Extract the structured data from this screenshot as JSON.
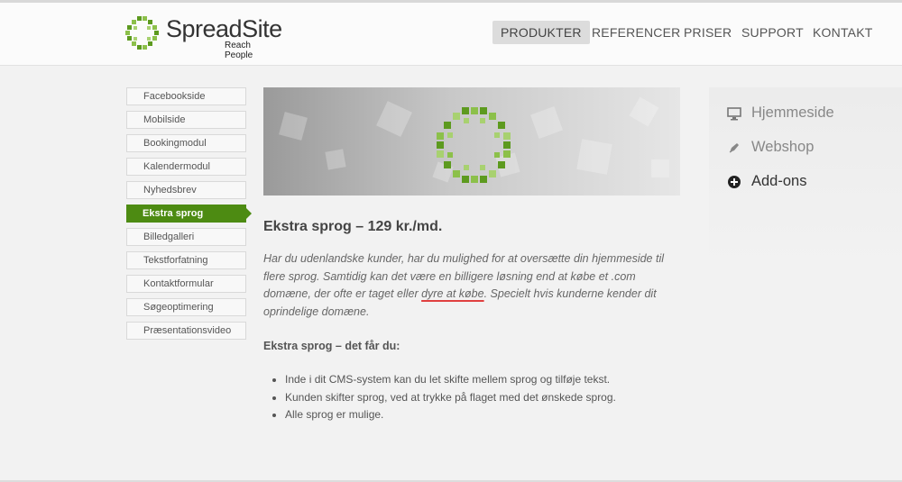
{
  "brand": {
    "name": "SpreadSite",
    "tagline": "Reach People",
    "accent": "#4d8b12"
  },
  "nav": {
    "items": [
      {
        "label": "PRODUKTER",
        "active": true
      },
      {
        "label": "REFERENCER",
        "active": false
      },
      {
        "label": "PRISER",
        "active": false
      },
      {
        "label": "SUPPORT",
        "active": false
      },
      {
        "label": "KONTAKT",
        "active": false
      }
    ]
  },
  "sidebar": {
    "items": [
      {
        "label": "Facebookside"
      },
      {
        "label": "Mobilside"
      },
      {
        "label": "Bookingmodul"
      },
      {
        "label": "Kalendermodul"
      },
      {
        "label": "Nyhedsbrev"
      },
      {
        "label": "Ekstra sprog",
        "active": true
      },
      {
        "label": "Billedgalleri"
      },
      {
        "label": "Tekstforfatning"
      },
      {
        "label": "Kontaktformular"
      },
      {
        "label": "Søgeoptimering"
      },
      {
        "label": "Præsentationsvideo"
      }
    ]
  },
  "content": {
    "title": "Ekstra sprog – 129 kr./md.",
    "intro_part1": "Har du udenlandske kunder, har du mulighed for at oversætte din hjemmeside til flere sprog. Samtidig kan det være en billigere løsning end at købe et .com domæne, der ofte er taget eller ",
    "intro_underlined": "dyre at købe",
    "intro_part2": ". Specielt hvis kunderne kender dit oprindelige domæne.",
    "subhead": "Ekstra sprog – det får du:",
    "bullets": [
      "Inde i dit CMS-system kan du let skifte mellem sprog og tilføje tekst.",
      "Kunden skifter sprog, ved at trykke på flaget med det ønskede sprog.",
      "Alle sprog er mulige."
    ]
  },
  "right_panel": {
    "items": [
      {
        "label": "Hjemmeside",
        "icon": "monitor-icon"
      },
      {
        "label": "Webshop",
        "icon": "pen-icon"
      },
      {
        "label": "Add-ons",
        "icon": "plus-circle-icon",
        "active": true
      }
    ]
  }
}
